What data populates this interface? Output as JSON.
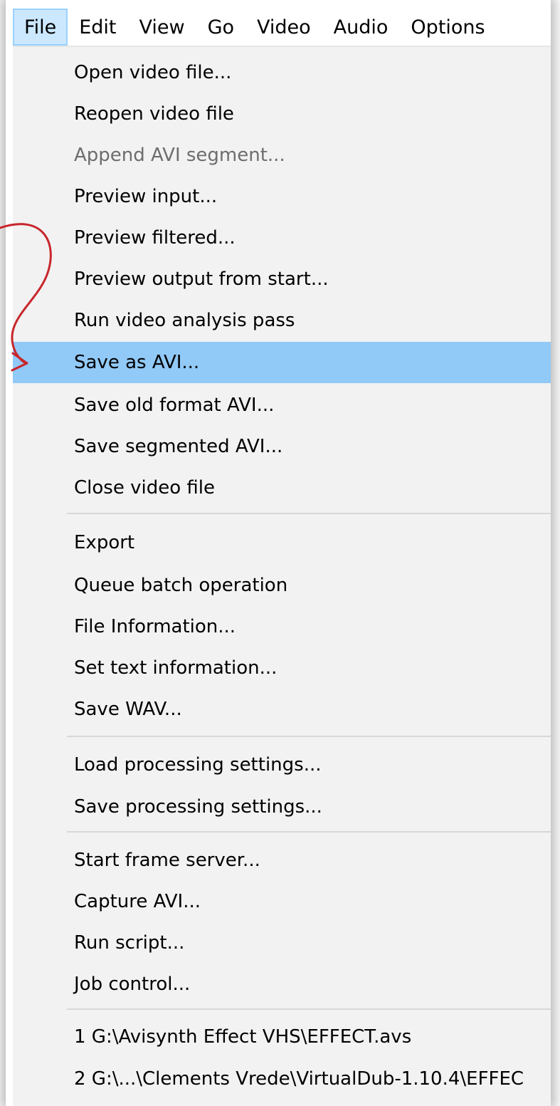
{
  "menubar": {
    "items": [
      {
        "label": "File",
        "active": true
      },
      {
        "label": "Edit"
      },
      {
        "label": "View"
      },
      {
        "label": "Go"
      },
      {
        "label": "Video"
      },
      {
        "label": "Audio"
      },
      {
        "label": "Options"
      }
    ]
  },
  "file_menu": {
    "items": [
      {
        "label": "Open video file..."
      },
      {
        "label": "Reopen video file"
      },
      {
        "label": "Append AVI segment...",
        "disabled": true
      },
      {
        "label": "Preview input..."
      },
      {
        "label": "Preview filtered..."
      },
      {
        "label": "Preview output from start..."
      },
      {
        "label": "Run video analysis pass"
      },
      {
        "label": "Save as AVI...",
        "highlighted": true
      },
      {
        "label": "Save old format AVI..."
      },
      {
        "label": "Save segmented AVI..."
      },
      {
        "label": "Close video file"
      },
      {
        "label": "Export"
      },
      {
        "label": "Queue batch operation"
      },
      {
        "label": "File Information..."
      },
      {
        "label": "Set text information..."
      },
      {
        "label": "Save WAV..."
      },
      {
        "label": "Load processing settings..."
      },
      {
        "label": "Save processing settings..."
      },
      {
        "label": "Start frame server..."
      },
      {
        "label": "Capture AVI..."
      },
      {
        "label": "Run script..."
      },
      {
        "label": "Job control..."
      },
      {
        "label": "1 G:\\Avisynth Effect VHS\\EFFECT.avs"
      },
      {
        "label": "2 G:\\...\\Clements Vrede\\VirtualDub-1.10.4\\EFFEC"
      }
    ]
  },
  "colors": {
    "active_menubar_bg": "#cce8ff",
    "highlight_bg": "#91c9f7",
    "menu_bg": "#f2f2f2",
    "disabled_text": "#6d6d6d",
    "annotation_arrow": "#c8262c"
  },
  "annotation": {
    "icon": "red-curved-arrow-icon",
    "points_to": "Save as AVI..."
  }
}
